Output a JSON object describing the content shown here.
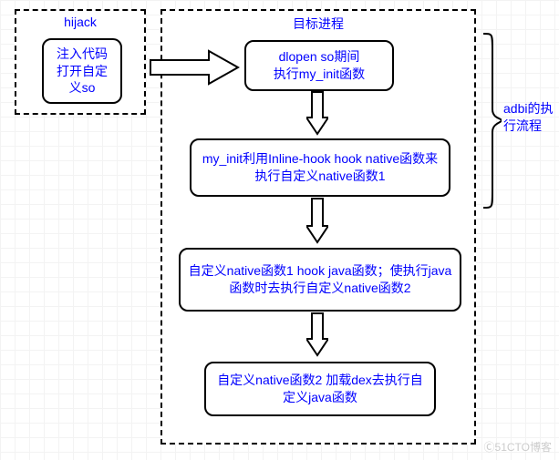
{
  "hijack": {
    "title": "hijack",
    "box": "注入代码打开自定义so"
  },
  "target": {
    "title": "目标进程",
    "step1": "dlopen so期间\n执行my_init函数",
    "step2": "my_init利用Inline-hook hook native函数来执行自定义native函数1",
    "step3": "自定义native函数1 hook java函数；使执行java函数时去执行自定义native函数2",
    "step4": "自定义native函数2 加载dex去执行自定义java函数"
  },
  "brace_label": "adbi的执行流程",
  "watermark": "Ⓒ51CTO博客"
}
